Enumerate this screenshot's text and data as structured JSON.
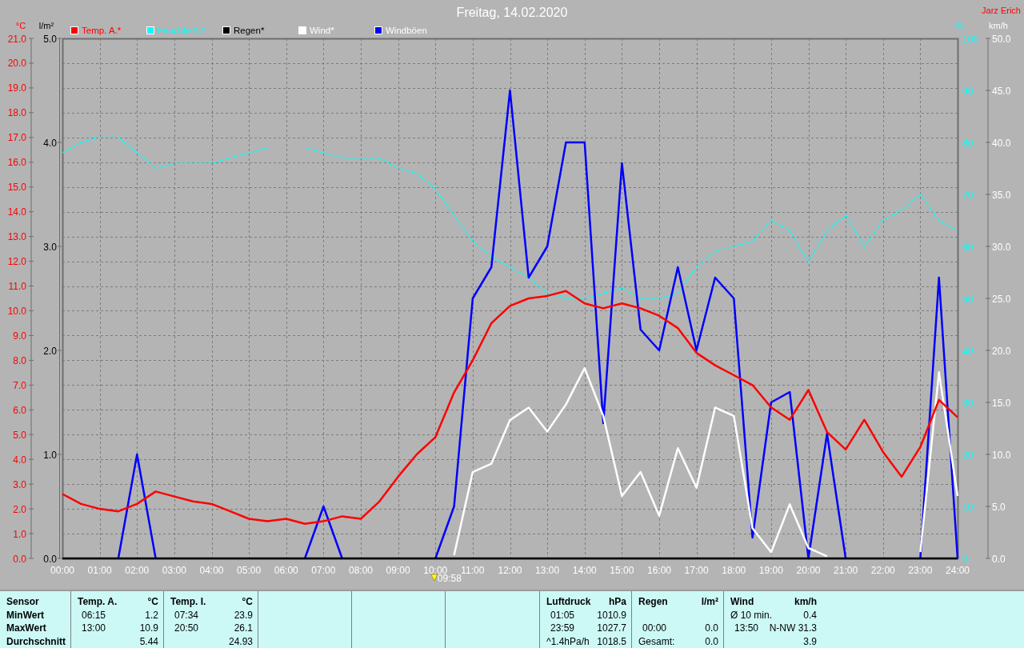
{
  "chart": {
    "author": "Jarz Erich",
    "marker_label": "09:58",
    "rain_axis": {
      "unit": "l/m²",
      "labels": [
        "5.0",
        "4.0",
        "3.0",
        "2.0",
        "1.0",
        "0.0"
      ]
    },
    "chart_data": {
      "type": "line",
      "title": "Freitag, 14.02.2020",
      "grid": true,
      "legend": "top",
      "ylabel": "°C",
      "xlim": [
        0,
        24
      ],
      "ylim": [
        0,
        21
      ],
      "y2label": "%",
      "y2lim": [
        0,
        100
      ],
      "y2ticks": [
        0,
        10,
        20,
        30,
        40,
        50,
        60,
        70,
        80,
        90,
        100
      ],
      "y3label": "km/h",
      "y3lim": [
        0,
        50
      ],
      "y3ticks": [
        {
          "value": 0,
          "label": "0.0"
        },
        {
          "value": 5,
          "label": "5.0"
        },
        {
          "value": 10,
          "label": "10.0"
        },
        {
          "value": 15,
          "label": "15.0"
        },
        {
          "value": 20,
          "label": "20.0"
        },
        {
          "value": 25,
          "label": "25.0"
        },
        {
          "value": 30,
          "label": "30.0"
        },
        {
          "value": 35,
          "label": "35.0"
        },
        {
          "value": 40,
          "label": "40.0"
        },
        {
          "value": 45,
          "label": "45.0"
        },
        {
          "value": 50,
          "label": "50.0"
        }
      ],
      "x": [
        0,
        0.5,
        1,
        1.5,
        2,
        2.5,
        3,
        3.5,
        4,
        4.5,
        5,
        5.5,
        6,
        6.5,
        7,
        7.5,
        8,
        8.5,
        9,
        9.5,
        10,
        10.5,
        11,
        11.5,
        12,
        12.5,
        13,
        13.5,
        14,
        14.5,
        15,
        15.5,
        16,
        16.5,
        17,
        17.5,
        18,
        18.5,
        19,
        19.5,
        20,
        20.5,
        21,
        21.5,
        22,
        22.5,
        23,
        23.5,
        24
      ],
      "xticks": [
        {
          "value": 0,
          "label": "00:00"
        },
        {
          "value": 1,
          "label": "01:00"
        },
        {
          "value": 2,
          "label": "02:00"
        },
        {
          "value": 3,
          "label": "03:00"
        },
        {
          "value": 4,
          "label": "04:00"
        },
        {
          "value": 5,
          "label": "05:00"
        },
        {
          "value": 6,
          "label": "06:00"
        },
        {
          "value": 7,
          "label": "07:00"
        },
        {
          "value": 8,
          "label": "08:00"
        },
        {
          "value": 9,
          "label": "09:00"
        },
        {
          "value": 10,
          "label": "10:00"
        },
        {
          "value": 11,
          "label": "11:00"
        },
        {
          "value": 12,
          "label": "12:00"
        },
        {
          "value": 13,
          "label": "13:00"
        },
        {
          "value": 14,
          "label": "14:00"
        },
        {
          "value": 15,
          "label": "15:00"
        },
        {
          "value": 16,
          "label": "16:00"
        },
        {
          "value": 17,
          "label": "17:00"
        },
        {
          "value": 18,
          "label": "18:00"
        },
        {
          "value": 19,
          "label": "19:00"
        },
        {
          "value": 20,
          "label": "20:00"
        },
        {
          "value": 21,
          "label": "21:00"
        },
        {
          "value": 22,
          "label": "22:00"
        },
        {
          "value": 23,
          "label": "23:00"
        },
        {
          "value": 24,
          "label": "24:00"
        }
      ],
      "yticks": [
        {
          "value": 0,
          "label": "0.0"
        },
        {
          "value": 1,
          "label": "1.0"
        },
        {
          "value": 2,
          "label": "2.0"
        },
        {
          "value": 3,
          "label": "3.0"
        },
        {
          "value": 4,
          "label": "4.0"
        },
        {
          "value": 5,
          "label": "5.0"
        },
        {
          "value": 6,
          "label": "6.0"
        },
        {
          "value": 7,
          "label": "7.0"
        },
        {
          "value": 8,
          "label": "8.0"
        },
        {
          "value": 9,
          "label": "9.0"
        },
        {
          "value": 10,
          "label": "10.0"
        },
        {
          "value": 11,
          "label": "11.0"
        },
        {
          "value": 12,
          "label": "12.0"
        },
        {
          "value": 13,
          "label": "13.0"
        },
        {
          "value": 14,
          "label": "14.0"
        },
        {
          "value": 15,
          "label": "15.0"
        },
        {
          "value": 16,
          "label": "16.0"
        },
        {
          "value": 17,
          "label": "17.0"
        },
        {
          "value": 18,
          "label": "18.0"
        },
        {
          "value": 19,
          "label": "19.0"
        },
        {
          "value": 20,
          "label": "20.0"
        },
        {
          "value": 21,
          "label": "21.0"
        }
      ],
      "series": [
        {
          "name": "Temp. A.*",
          "color": "#ff0000",
          "values": [
            2.6,
            2.2,
            2.0,
            1.9,
            2.2,
            2.7,
            2.5,
            2.3,
            2.2,
            1.9,
            1.6,
            1.5,
            1.6,
            1.4,
            1.5,
            1.7,
            1.6,
            2.3,
            3.3,
            4.2,
            4.9,
            6.7,
            8.0,
            9.5,
            10.2,
            10.5,
            10.6,
            10.8,
            10.3,
            10.1,
            10.3,
            10.1,
            9.8,
            9.3,
            8.3,
            7.8,
            7.4,
            7.0,
            6.1,
            5.6,
            6.8,
            5.1,
            4.4,
            5.6,
            4.3,
            3.3,
            4.5,
            6.4,
            5.7
          ]
        },
        {
          "name": "Feuchte A.*",
          "color": "#00ffff",
          "axis": "y2",
          "line_style": "dashed",
          "values": [
            78,
            80,
            81,
            81,
            78,
            75,
            76,
            76,
            76,
            77,
            78,
            79,
            79,
            79,
            78,
            77,
            77,
            77,
            75,
            74,
            71,
            66,
            61,
            58,
            56,
            54,
            51,
            50,
            50,
            51,
            52,
            50,
            50,
            51,
            56,
            59,
            60,
            61,
            65,
            63,
            57,
            63,
            66,
            60,
            65,
            67,
            70,
            65,
            63
          ]
        },
        {
          "name": "Regen*",
          "color": "#000000",
          "values": [
            0,
            0,
            0,
            0,
            0,
            0,
            0,
            0,
            0,
            0,
            0,
            0,
            0,
            0,
            0,
            0,
            0,
            0,
            0,
            0,
            0,
            0,
            0,
            0,
            0,
            0,
            0,
            0,
            0,
            0,
            0,
            0,
            0,
            0,
            0,
            0,
            0,
            0,
            0,
            0,
            0,
            0,
            0,
            0,
            0,
            0,
            0,
            0,
            0
          ]
        },
        {
          "name": "Wind*",
          "color": "#ffffff",
          "axis": "y3",
          "values": [
            null,
            null,
            null,
            null,
            null,
            null,
            null,
            null,
            null,
            null,
            null,
            null,
            null,
            null,
            null,
            null,
            null,
            null,
            null,
            null,
            null,
            0.3,
            8.3,
            9.1,
            13.3,
            14.5,
            12.2,
            14.8,
            18.3,
            13.7,
            6.0,
            8.3,
            4.1,
            10.6,
            6.8,
            14.5,
            13.7,
            2.9,
            0.6,
            5.2,
            1.0,
            0.2,
            null,
            null,
            null,
            null,
            0.6,
            17.9,
            6.0
          ]
        },
        {
          "name": "Windböen",
          "color": "#0000ff",
          "axis": "y3",
          "values": [
            null,
            null,
            null,
            0,
            10,
            0,
            null,
            null,
            null,
            null,
            null,
            null,
            null,
            0,
            5,
            0,
            null,
            null,
            null,
            null,
            0,
            5,
            25,
            28,
            45,
            27,
            30,
            40,
            40,
            13,
            38,
            22,
            20,
            28,
            20,
            27,
            25,
            2,
            15,
            16,
            0,
            12,
            0,
            null,
            null,
            null,
            0,
            27,
            0
          ]
        }
      ]
    }
  },
  "stats": {
    "panels": [
      {
        "kind": "labels",
        "rows": [
          "Sensor",
          "MinWert",
          "MaxWert",
          "Durchschnitt"
        ]
      },
      {
        "kind": "values",
        "header": "Temp. A.",
        "unit": "°C",
        "rows": [
          {
            "time": "06:15",
            "value": "1.2"
          },
          {
            "time": "13:00",
            "value": "10.9"
          },
          {
            "value": "5.44"
          }
        ]
      },
      {
        "kind": "values",
        "header": "Temp. I.",
        "unit": "°C",
        "rows": [
          {
            "time": "07:34",
            "value": "23.9"
          },
          {
            "time": "20:50",
            "value": "26.1"
          },
          {
            "value": "24.93"
          }
        ]
      },
      {
        "kind": "empty"
      },
      {
        "kind": "empty"
      },
      {
        "kind": "empty"
      },
      {
        "kind": "values",
        "header": "Luftdruck",
        "unit": "hPa",
        "rows": [
          {
            "time": "01:05",
            "value": "1010.9"
          },
          {
            "time": "23:59",
            "value": "1027.7"
          },
          {
            "time": "^1.4hPa/h",
            "value": "1018.5"
          }
        ]
      },
      {
        "kind": "values",
        "header": "Regen",
        "unit": "l/m²",
        "rows": [
          {},
          {
            "time": "00:00",
            "value": "0.0"
          },
          {
            "time": "Gesamt:",
            "value": "0.0"
          }
        ]
      },
      {
        "kind": "values",
        "header": "Wind",
        "unit": "km/h",
        "rows": [
          {
            "time": "Ø 10 min.",
            "value": "0.4"
          },
          {
            "time": "13:50",
            "value": "N-NW 31.3"
          },
          {
            "value": "3.9"
          }
        ]
      }
    ]
  }
}
